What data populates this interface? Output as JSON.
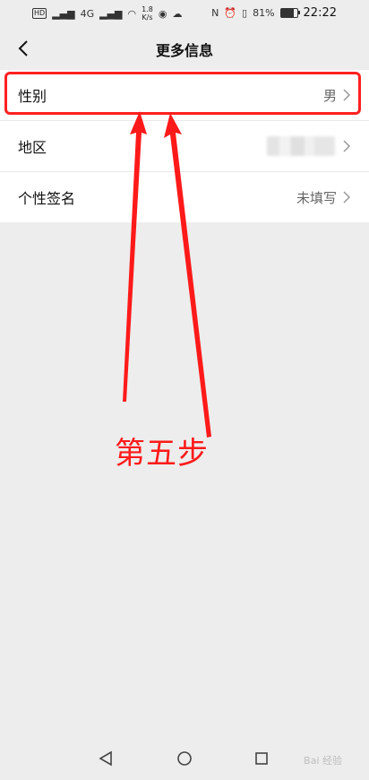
{
  "status_bar": {
    "speed_value": "1.8",
    "speed_unit": "K/s",
    "network": "4G",
    "battery": "81%",
    "time": "22:22"
  },
  "header": {
    "title": "更多信息"
  },
  "rows": [
    {
      "label": "性别",
      "value": "男"
    },
    {
      "label": "地区",
      "value": ""
    },
    {
      "label": "个性签名",
      "value": "未填写"
    }
  ],
  "annotation": {
    "step_text": "第五步",
    "color": "#ff1a1a"
  },
  "watermark": "Bai 经验"
}
